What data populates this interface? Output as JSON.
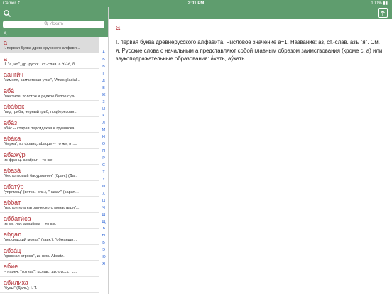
{
  "status_bar": {
    "carrier": "Carrier ⇡",
    "time": "2:01 PM",
    "battery": "100% ▮▮"
  },
  "search": {
    "placeholder": "Искать"
  },
  "list": {
    "section_header": "А",
    "items": [
      {
        "headword": "а",
        "definition": "I. первая буква древнерусского алфави..."
      },
      {
        "headword": "а",
        "definition": "II. \"а, но\", др.-русск., ст.-слав. а ἀλλά, б..."
      },
      {
        "headword": "аангӥч",
        "definition": "\"зимняя, камчатская утка\", \"Anas glacial..."
      },
      {
        "headword": "аба́",
        "definition": "\"местное, толстое и редкое белое сукн..."
      },
      {
        "headword": "аба́бок",
        "definition": "\"вид гриба, черный гриб, подберезови..."
      },
      {
        "headword": "аба́з",
        "definition": "аба́с -- старая персидская и грузинска..."
      },
      {
        "headword": "аба́ка",
        "definition": "\"бирка\", из франц. abaque -- то же; ит...."
      },
      {
        "headword": "абажу́р",
        "definition": "из франц. abatjour -- то же."
      },
      {
        "headword": "абаза́",
        "definition": "\"бестолковый басурманин\" (бран.) (Да..."
      },
      {
        "headword": "абату́р",
        "definition": "\"упрямец\" (вятск., ряз.), \"нахал\" (сарат...."
      },
      {
        "headword": "абба́т",
        "definition": "\"настоятель католического монастыря\"..."
      },
      {
        "headword": "аббати́са",
        "definition": "из ср.-лат. abbatissa -- то же."
      },
      {
        "headword": "абда́л",
        "definition": "\"персидский монах\" (кавк.), \"обманщи..."
      },
      {
        "headword": "абза́ц",
        "definition": "\"красная строка\", из нем. Absatz."
      },
      {
        "headword": "абие",
        "definition": "-- нареч. \"тотчас\", цслав., др.-русск., с..."
      },
      {
        "headword": "абилиха",
        "definition": "\"бусы\" (Даль); I. Т."
      }
    ]
  },
  "alphabet_index": [
    "А",
    "Б",
    "В",
    "Г",
    "Д",
    "Е",
    "Ж",
    "З",
    "И",
    "К",
    "Л",
    "М",
    "Н",
    "О",
    "П",
    "Р",
    "С",
    "Т",
    "У",
    "Ф",
    "Х",
    "Ц",
    "Ч",
    "Ш",
    "Щ",
    "Ъ",
    "Ы",
    "Ь",
    "Э",
    "Ю",
    "Я"
  ],
  "content": {
    "title": "а",
    "body": "I. первая буква древнерусского алфавита. Числовое значение а̃=1. Название: аз, ст.-слав. азъ \"я\". См. я. Русские слова с начальным а представляют собой главным образом заимствования (кроме с. а) или звукоподражательные образования: а́хать, ау́кать."
  },
  "colors": {
    "accent": "#5f9d6e",
    "headword": "#b22d33",
    "index": "#2a63d6"
  }
}
